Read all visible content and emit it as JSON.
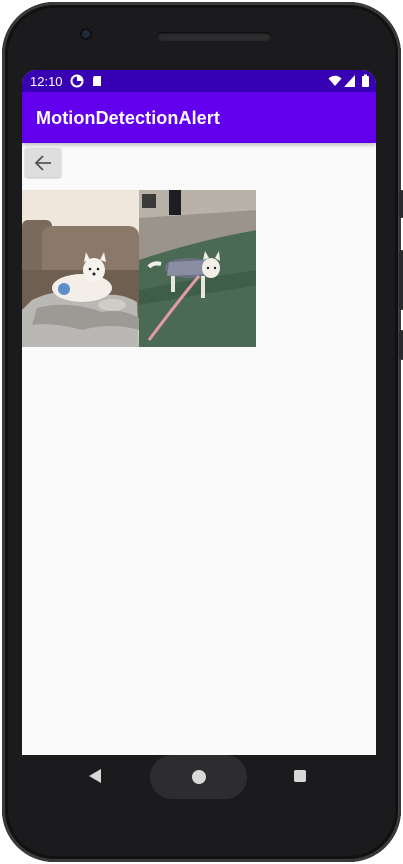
{
  "status_bar": {
    "time": "12:10",
    "left_icons": [
      "data-saver-icon",
      "sd-card-icon"
    ],
    "right_icons": [
      "wifi-icon",
      "signal-icon",
      "battery-icon"
    ]
  },
  "app_bar": {
    "title": "MotionDetectionAlert",
    "color": "#6200ee",
    "status_color": "#3700b3"
  },
  "content": {
    "back_button_icon": "arrow-back-icon",
    "photos": [
      {
        "label": "dog-on-couch-photo"
      },
      {
        "label": "dog-on-leash-photo"
      }
    ]
  },
  "nav_bar": {
    "buttons": [
      "back-triangle-icon",
      "home-circle-icon",
      "recents-square-icon"
    ]
  }
}
